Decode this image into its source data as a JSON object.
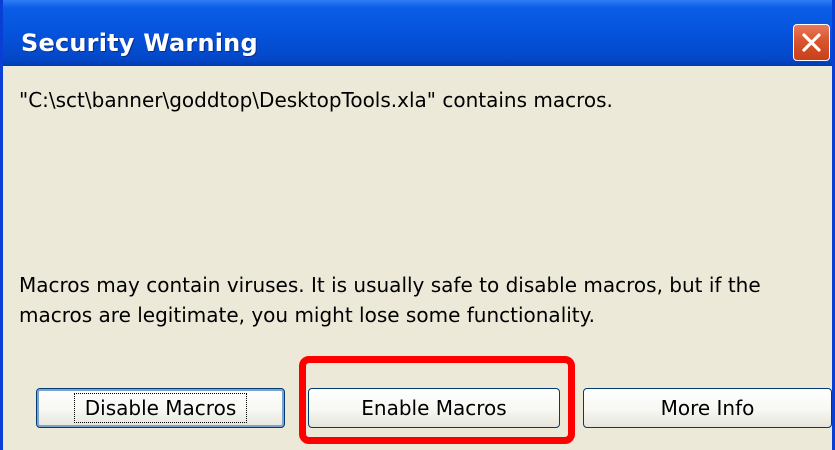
{
  "window": {
    "title": "Security Warning",
    "close_icon": "close-icon"
  },
  "message": {
    "path_text": "\"C:\\sct\\banner\\goddtop\\DesktopTools.xla\" contains macros.",
    "warning_text": "Macros may contain viruses. It is usually safe to disable macros, but if the macros are legitimate, you might lose some functionality."
  },
  "buttons": {
    "disable_label": "Disable Macros",
    "enable_label": "Enable Macros",
    "more_info_label": "More Info"
  },
  "colors": {
    "titlebar": "#0553dc",
    "dialog_bg": "#ece9d8",
    "close_button": "#d8552e",
    "highlight": "#ff0000"
  }
}
